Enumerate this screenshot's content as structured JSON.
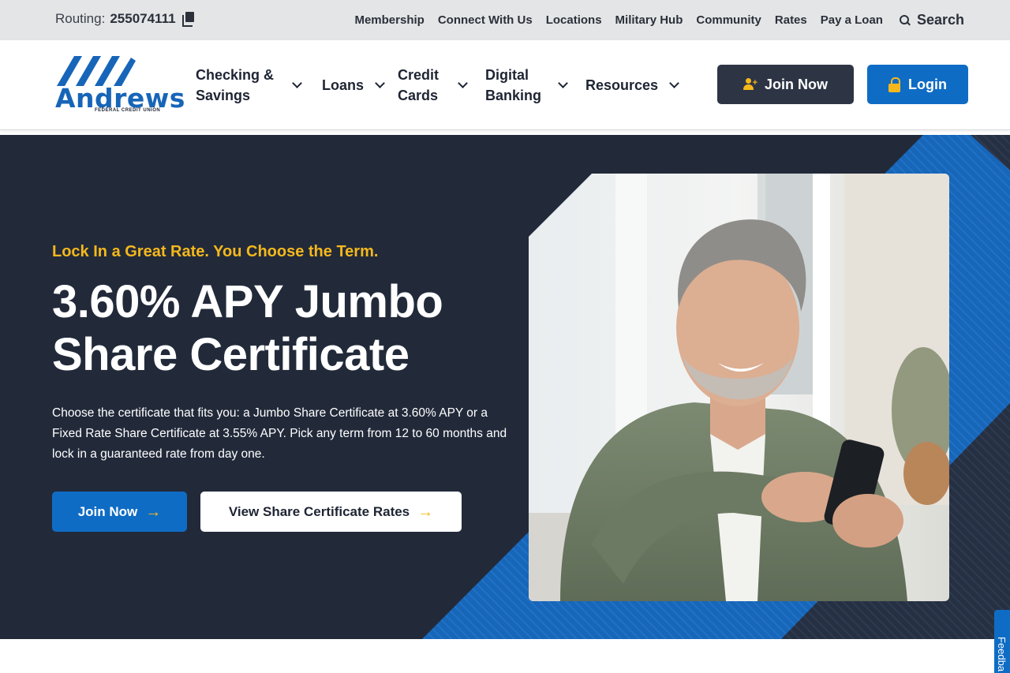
{
  "utility": {
    "routing_label": "Routing:",
    "routing_number": "255074111",
    "links": [
      "Membership",
      "Connect With Us",
      "Locations",
      "Military Hub",
      "Community",
      "Rates",
      "Pay a Loan"
    ],
    "search_label": "Search"
  },
  "brand": {
    "name": "Andrews",
    "subtitle": "FEDERAL CREDIT UNION",
    "primary_color": "#0f6cc4",
    "dark_color": "#222a3a",
    "accent_color": "#f5b81c"
  },
  "nav": {
    "items": [
      {
        "label": "Checking & Savings"
      },
      {
        "label": "Loans"
      },
      {
        "label": "Credit Cards"
      },
      {
        "label": "Digital Banking"
      },
      {
        "label": "Resources"
      }
    ],
    "join_label": "Join Now",
    "login_label": "Login"
  },
  "hero": {
    "eyebrow": "Lock In a Great Rate. You Choose the Term.",
    "title": "3.60% APY Jumbo Share Certificate",
    "body": "Choose the certificate that fits you: a Jumbo Share Certificate at 3.60% APY or a Fixed Rate Share Certificate at 3.55% APY. Pick any term from 12 to 60 months and lock in a guaranteed rate from day one.",
    "primary_cta": "Join Now",
    "secondary_cta": "View Share Certificate Rates",
    "arrow": "→"
  },
  "feedback": {
    "label": "Feedba"
  }
}
